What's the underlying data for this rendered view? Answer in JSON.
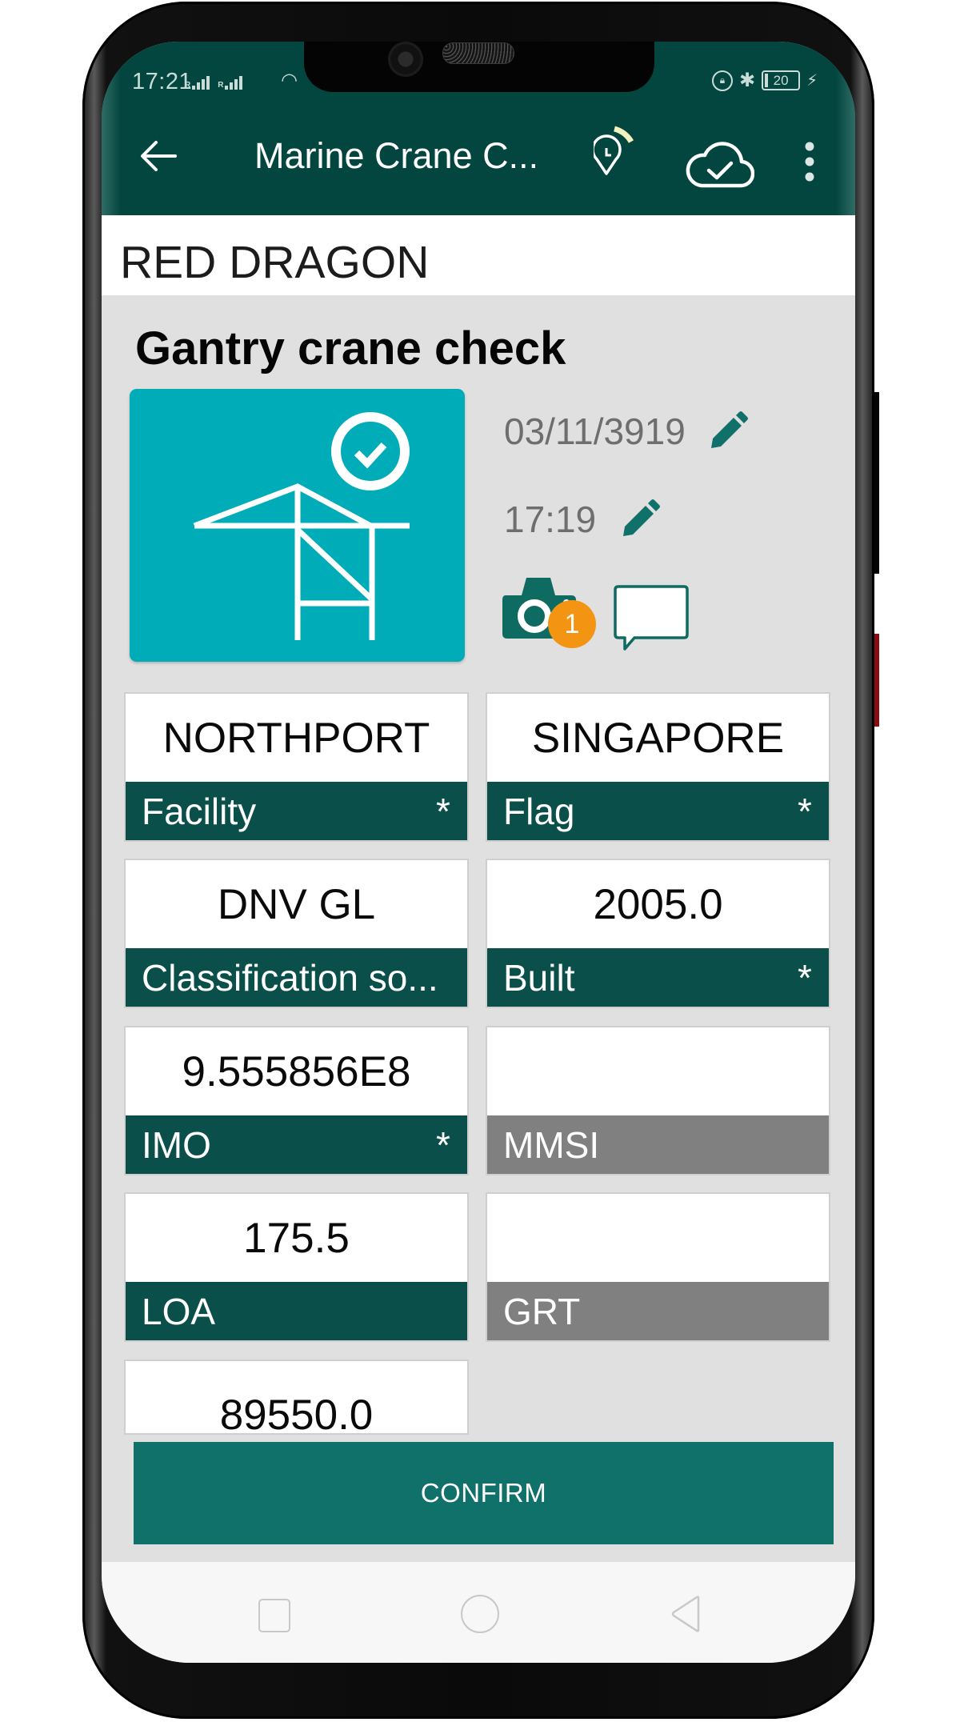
{
  "status_bar": {
    "time": "17:21",
    "signal_1_label": "R",
    "signal_2_label": "R",
    "battery_level": "20",
    "icons": [
      "signal-icon",
      "signal-icon",
      "wifi-icon",
      "rotation-lock-icon",
      "bluetooth-icon",
      "battery-icon",
      "charging-icon"
    ]
  },
  "app_bar": {
    "title": "Marine Crane C...",
    "back_icon": "arrow-left-icon",
    "actions": [
      "location-clock-icon",
      "cloud-check-icon",
      "more-vert-icon"
    ]
  },
  "vessel": {
    "name": "RED DRAGON"
  },
  "inspection": {
    "title": "Gantry crane check",
    "image_icon": "gantry-crane-check-icon",
    "date": "03/11/3919",
    "time": "17:19",
    "photo_count": "1",
    "colors": {
      "hero_bg": "#00ACB7",
      "badge": "#F39513",
      "accent": "#0B4F4A"
    }
  },
  "fields": [
    {
      "value": "NORTHPORT",
      "label": "Facility",
      "required": true,
      "required_mark": "*",
      "filled": true
    },
    {
      "value": "SINGAPORE",
      "label": "Flag",
      "required": true,
      "required_mark": "*",
      "filled": true
    },
    {
      "value": "DNV GL",
      "label": "Classification so...",
      "required": false,
      "required_mark": "",
      "filled": true
    },
    {
      "value": "2005.0",
      "label": "Built",
      "required": true,
      "required_mark": "*",
      "filled": true
    },
    {
      "value": "9.555856E8",
      "label": "IMO",
      "required": true,
      "required_mark": "*",
      "filled": true
    },
    {
      "value": "",
      "label": "MMSI",
      "required": false,
      "required_mark": "",
      "filled": false
    },
    {
      "value": "175.5",
      "label": "LOA",
      "required": false,
      "required_mark": "",
      "filled": true
    },
    {
      "value": "",
      "label": "GRT",
      "required": false,
      "required_mark": "",
      "filled": false
    },
    {
      "value": "89550.0",
      "label": "",
      "required": false,
      "required_mark": "",
      "filled": true
    }
  ],
  "actions": {
    "confirm_label": "CONFIRM"
  },
  "nav_bar": {
    "buttons": [
      "recent-apps-icon",
      "home-icon",
      "back-triangle-icon"
    ]
  }
}
